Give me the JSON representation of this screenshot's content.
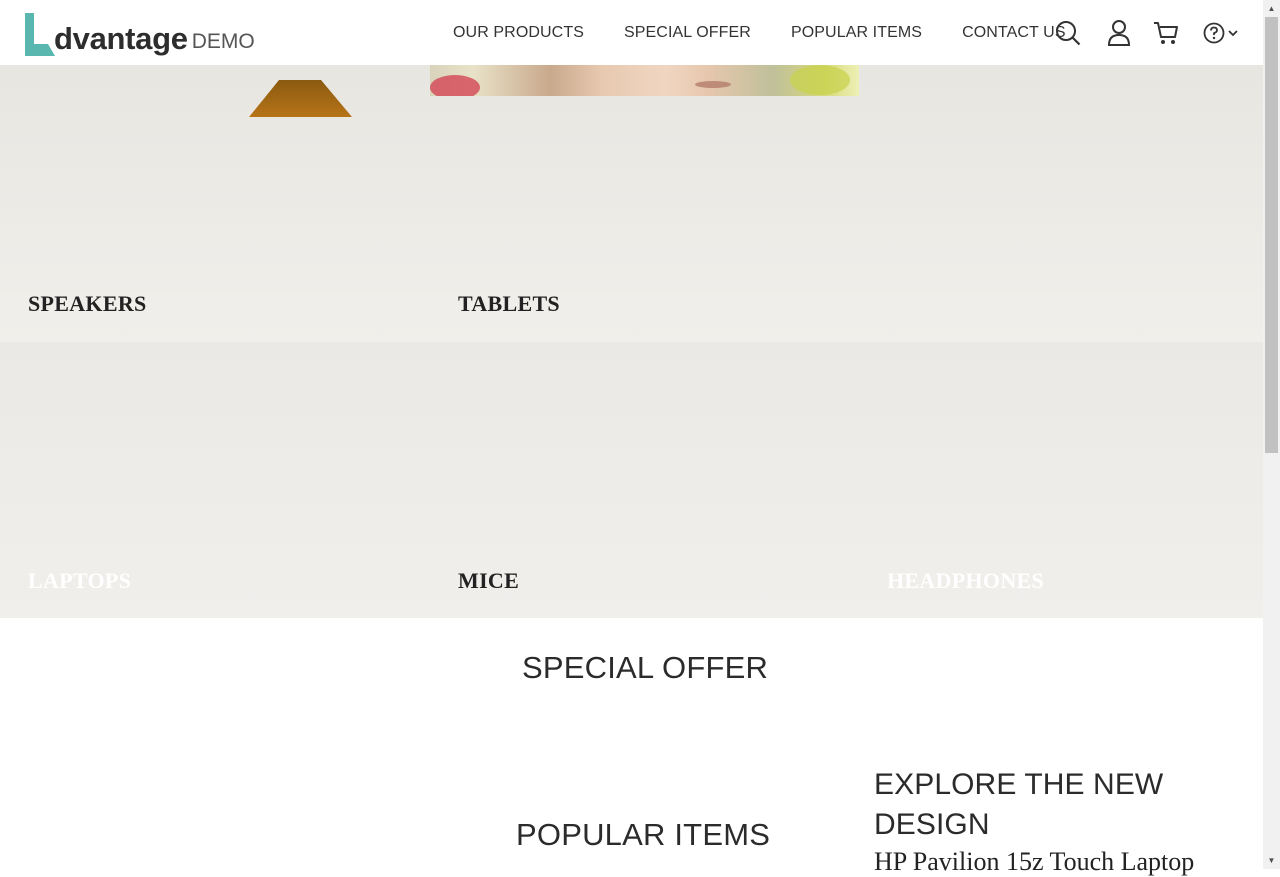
{
  "logo": {
    "word": "dvantage",
    "suffix": "DEMO",
    "accent_color": "#59b7b0"
  },
  "nav": {
    "items": [
      {
        "label": "OUR PRODUCTS"
      },
      {
        "label": "SPECIAL OFFER"
      },
      {
        "label": "POPULAR ITEMS"
      },
      {
        "label": "CONTACT US"
      }
    ],
    "icons": [
      "search-icon",
      "user-icon",
      "cart-icon",
      "help-icon",
      "chevron-down-icon"
    ]
  },
  "categories": {
    "speakers": "SPEAKERS",
    "tablets": "TABLETS",
    "laptops": "LAPTOPS",
    "mice": "MICE",
    "headphones": "HEADPHONES"
  },
  "sections": {
    "special_offer": "SPECIAL OFFER",
    "popular_items": "POPULAR ITEMS",
    "explore_heading": "EXPLORE THE NEW DESIGN",
    "explore_product": "HP Pavilion 15z Touch Laptop"
  }
}
